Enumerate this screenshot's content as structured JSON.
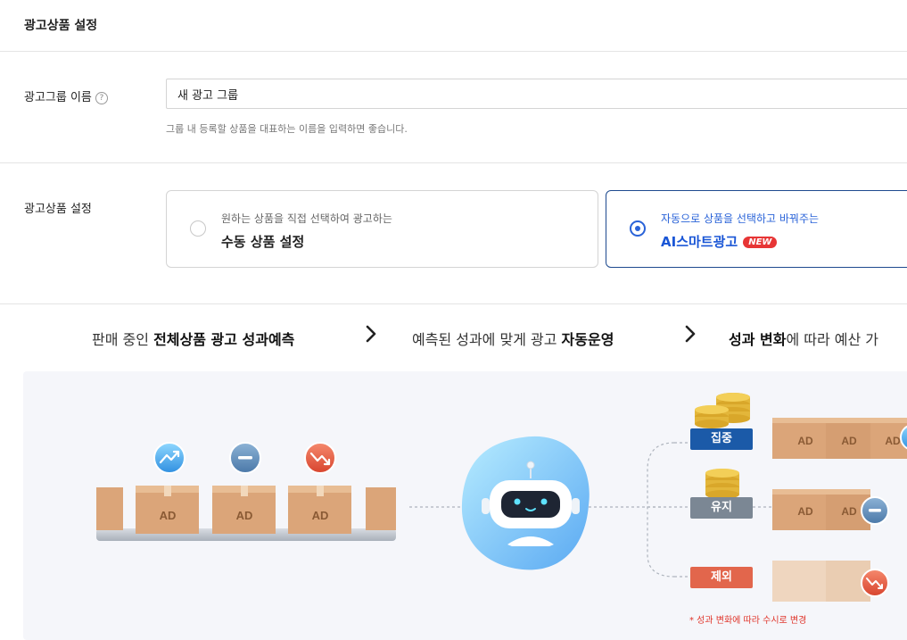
{
  "section": {
    "title": "광고상품 설정"
  },
  "group_name": {
    "label": "광고그룹 이름",
    "help_icon": "question-circle-icon",
    "value": "새 광고 그룹",
    "hint": "그룹 내 등록할 상품을 대표하는 이름을 입력하면 좋습니다."
  },
  "product_setting": {
    "label": "광고상품 설정",
    "options": [
      {
        "sub": "원하는 상품을 직접 선택하여 광고하는",
        "title": "수동 상품 설정",
        "selected": false
      },
      {
        "sub": "자동으로 상품을 선택하고 바꿔주는",
        "title": "AI스마트광고",
        "badge": "NEW",
        "selected": true
      }
    ]
  },
  "flow": {
    "step1_pre": "판매 중인 ",
    "step1_bold": "전체상품 광고 성과예측",
    "step2_pre": "예측된 성과에 맞게 광고 ",
    "step2_bold": "자동운영",
    "step3_bold": "성과 변화",
    "step3_post": "에 따라 예산 가",
    "arrow_icon": "chevron-right-icon"
  },
  "illustration": {
    "box_label": "AD",
    "tags": [
      {
        "label": "집중",
        "color": "#1b5aa8"
      },
      {
        "label": "유지",
        "color": "#7b8794"
      },
      {
        "label": "제외",
        "color": "#e2664c"
      }
    ],
    "note": "* 성과 변화에 따라 수시로 변경"
  },
  "colors": {
    "accent": "#2a63d8",
    "badge": "#e73535",
    "box": "#dba579",
    "illustration_bg": "#f5f6fa"
  }
}
